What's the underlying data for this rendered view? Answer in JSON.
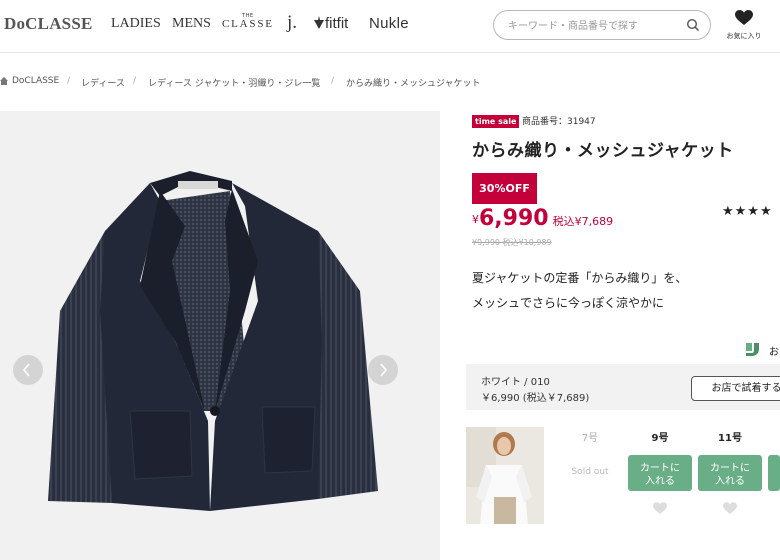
{
  "header": {
    "logo": "DoCLASSE",
    "nav": {
      "ladies": "LADIES",
      "mens": "MENS",
      "classe_small": "THE",
      "classe_main": "CLASSE",
      "j": "j.",
      "fitfit": "fitfit",
      "nukle": "Nukle"
    },
    "search_placeholder": "キーワード・商品番号で探す",
    "favorite_label": "お気に入り"
  },
  "breadcrumb": {
    "home": "DoCLASSE",
    "items": [
      "レディース",
      "レディース ジャケット・羽織り・ジレ一覧",
      "からみ織り・メッシュジャケット"
    ],
    "separator": "/"
  },
  "product": {
    "badge": "time sale",
    "item_number": "商品番号：31947",
    "title": "からみ織り・メッシュジャケット",
    "discount": "30%OFF",
    "price_yen": "¥",
    "price": "6,990",
    "price_tax": "税込¥7,689",
    "original_price": "¥9,990 税込¥10,989",
    "stars": "★★★★",
    "description": [
      "夏ジャケットの定番「からみ織り」を、",
      "メッシュでさらに今っぽく涼やかに"
    ],
    "store_text": "お"
  },
  "variant": {
    "color": "ホワイト / 010",
    "price": "￥6,990 (税込￥7,689)",
    "try_in_store": "お店で試着する",
    "sizes": [
      {
        "label": "7号",
        "status": "Sold out"
      },
      {
        "label": "9号",
        "cart": [
          "カートに",
          "入れる"
        ]
      },
      {
        "label": "11号",
        "cart": [
          "カートに",
          "入れる"
        ]
      }
    ]
  },
  "colors": {
    "accent_red": "#c3003a",
    "cart_green": "#6aae87",
    "jacket_navy": "#232838"
  }
}
